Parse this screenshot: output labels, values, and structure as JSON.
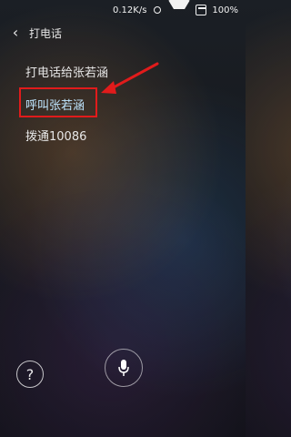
{
  "status_bar": {
    "network_speed": "0.12K/s",
    "battery": "100%",
    "icons": [
      "alarm-icon",
      "wifi-icon",
      "battery-icon"
    ]
  },
  "header": {
    "title": "打电话",
    "back_icon": "chevron-left-icon"
  },
  "results": [
    {
      "label": "打电话给张若涵"
    },
    {
      "label": "呼叫张若涵"
    },
    {
      "label": "拨通10086"
    }
  ],
  "annotation": {
    "box_color": "#e11b1b",
    "arrow_color": "#e11b1b"
  },
  "bottom": {
    "help_label": "?",
    "mic_icon": "microphone-icon"
  }
}
